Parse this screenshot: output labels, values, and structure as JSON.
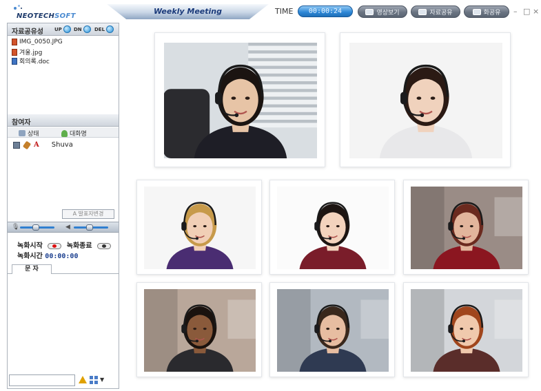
{
  "app": {
    "logo_text_a": "NEOTECH",
    "logo_text_b": "SOFT",
    "meeting_title": "Weekly Meeting",
    "time_label": "TIME",
    "time_value": "00:00:24",
    "buttons": [
      "영상보기",
      "자료공유",
      "화공유"
    ],
    "window_controls": {
      "minimize": "–",
      "maximize": "□",
      "close": "×"
    }
  },
  "sidebar": {
    "share_section": {
      "title": "자료공유성",
      "up_label": "UP",
      "dn_label": "DN",
      "del_label": "DEL",
      "files": [
        {
          "name": "IMG_0050.JPG",
          "type": "image"
        },
        {
          "name": "겨울.jpg",
          "type": "image"
        },
        {
          "name": "회의록.doc",
          "type": "doc"
        }
      ]
    },
    "participants": {
      "title": "참여자",
      "col_state": "상태",
      "col_nickname": "대화명",
      "users": [
        {
          "name": "Shuva",
          "badge": "A"
        }
      ],
      "chat_button": "A 발표자변경"
    },
    "record": {
      "start_label": "녹화시작",
      "stop_label": "녹화종료",
      "time_label": "녹화시간",
      "time_value": "00:00:00"
    },
    "chat": {
      "tab_label": "문 자",
      "input_value": ""
    }
  },
  "video": {
    "tiles": [
      {
        "name": "participant-1",
        "scene": "office-window",
        "skin": "#e7c4a6",
        "hair": "#1b1411",
        "shirt": "#1e1e26",
        "bg": "#d9dee2"
      },
      {
        "name": "participant-2",
        "scene": "plain",
        "skin": "#f0d2bd",
        "hair": "#2b1a14",
        "shirt": "#e8e8ea",
        "bg": "#f4f4f4"
      },
      {
        "name": "participant-3",
        "scene": "plain",
        "skin": "#f1cfb6",
        "hair": "#c79a4a",
        "shirt": "#4a2d72",
        "bg": "#f6f6f6"
      },
      {
        "name": "participant-4",
        "scene": "plain",
        "skin": "#f3d3bd",
        "hair": "#1d1512",
        "shirt": "#7a1d2a",
        "bg": "#fbfbfb"
      },
      {
        "name": "participant-5",
        "scene": "office",
        "skin": "#e2b59c",
        "hair": "#6b2a1f",
        "shirt": "#8b1620",
        "bg": "#9a8c86"
      },
      {
        "name": "participant-6",
        "scene": "office",
        "skin": "#8a5a3b",
        "hair": "#1a120e",
        "shirt": "#2a2a2e",
        "bg": "#b9a79a"
      },
      {
        "name": "participant-7",
        "scene": "office",
        "skin": "#e7bda1",
        "hair": "#3a281c",
        "shirt": "#2f3a52",
        "bg": "#b2b9c1"
      },
      {
        "name": "participant-8",
        "scene": "office",
        "skin": "#f0c9ad",
        "hair": "#a0461d",
        "shirt": "#5a2d2a",
        "bg": "#d3d6da"
      }
    ]
  }
}
